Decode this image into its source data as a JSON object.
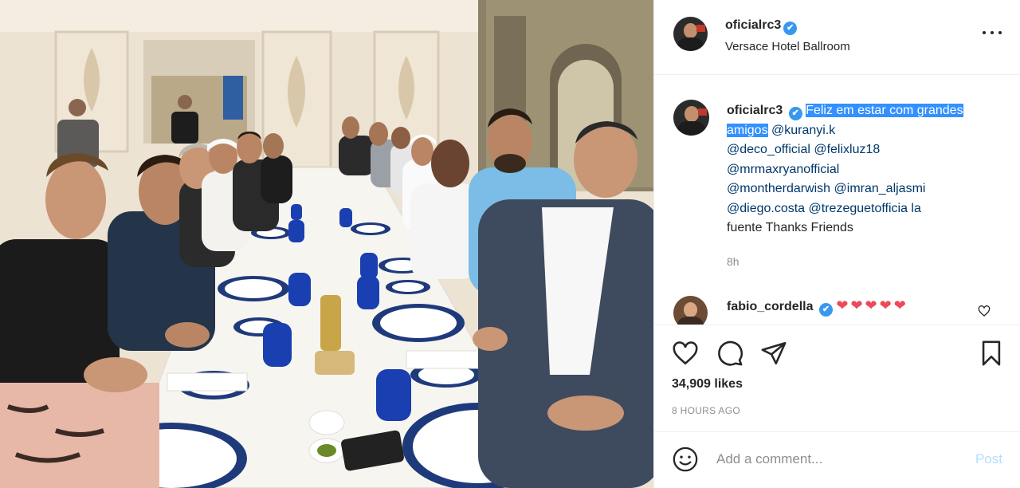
{
  "post": {
    "username": "oficialrc3",
    "location": "Versace Hotel Ballroom",
    "verified_mark": "✔",
    "more_icon": "more-horizontal-icon"
  },
  "caption": {
    "username": "oficialrc3",
    "highlighted_text": "Feliz em estar com grandes amigos",
    "line1": " @kuranyi.k",
    "line2": "@deco_official @felixluz18",
    "line3": "@mrmaxryanofficial",
    "line4": "@montherdarwish @imran_aljasmi",
    "line5": "@diego.costa @trezeguetofficia la",
    "line6": "fuente Thanks Friends",
    "time": "8h"
  },
  "comment": {
    "username": "fabio_cordella",
    "hearts": "❤❤❤❤❤"
  },
  "actions": {
    "like_icon": "heart-icon",
    "comment_icon": "comment-icon",
    "share_icon": "share-icon",
    "save_icon": "bookmark-icon",
    "likes": "34,909 likes",
    "timestamp": "8 HOURS AGO"
  },
  "add_comment": {
    "placeholder": "Add a comment...",
    "post_label": "Post",
    "emoji_icon": "emoji-icon"
  },
  "colors": {
    "verified": "#3897f0",
    "selection": "#3390ff",
    "mention": "#00376b",
    "muted": "#8e8e8e",
    "post_disabled": "#b2dffc",
    "heart_red": "#ed4956"
  }
}
